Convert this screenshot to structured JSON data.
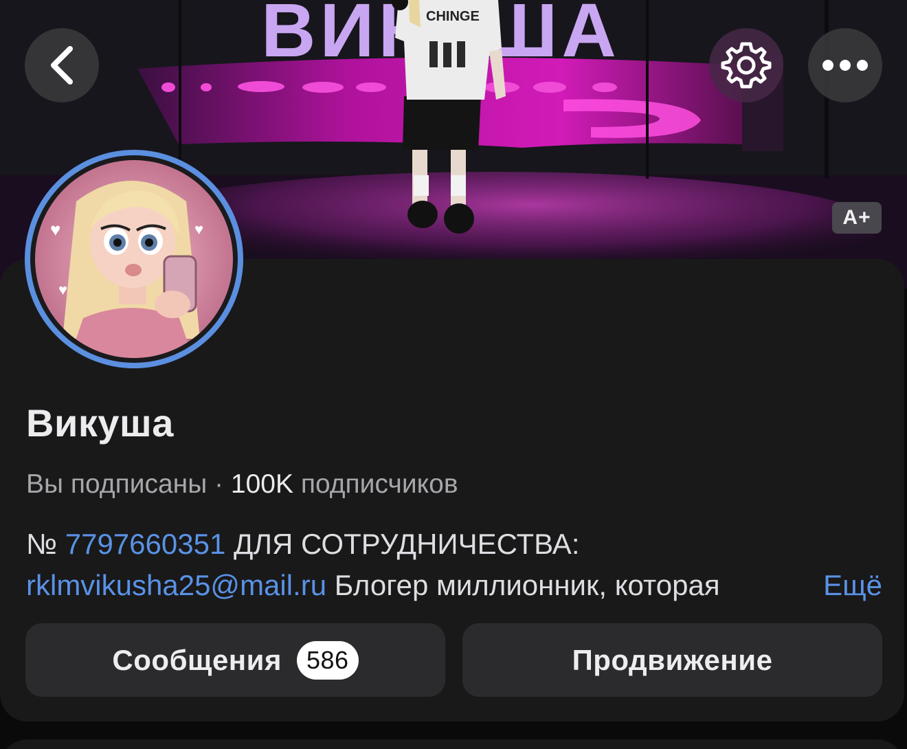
{
  "cover": {
    "banner_text": "ВИКУША",
    "shirt_text": "CHINGE",
    "font_size_badge": "A+"
  },
  "header": {
    "back_icon": "chevron-left-icon",
    "settings_icon": "gear-icon",
    "more_icon": "ellipsis-icon"
  },
  "profile": {
    "name": "Викуша",
    "subscription_status": "Вы подписаны",
    "separator": " · ",
    "followers": "100K",
    "followers_label": " подписчиков",
    "bio_prefix": "№ ",
    "phone": "7797660351",
    "bio_after_phone": " ДЛЯ СОТРУДНИЧЕСТВА:",
    "email": "rklmvikusha25@mail.ru",
    "bio_continuation": "  Блогер миллионник, которая",
    "more_label": "Ещё",
    "avatar_ring_color": "#5b8fe0",
    "link_color": "#5a92e6"
  },
  "actions": {
    "messages_label": "Сообщения",
    "messages_count": "586",
    "promotion_label": "Продвижение"
  }
}
